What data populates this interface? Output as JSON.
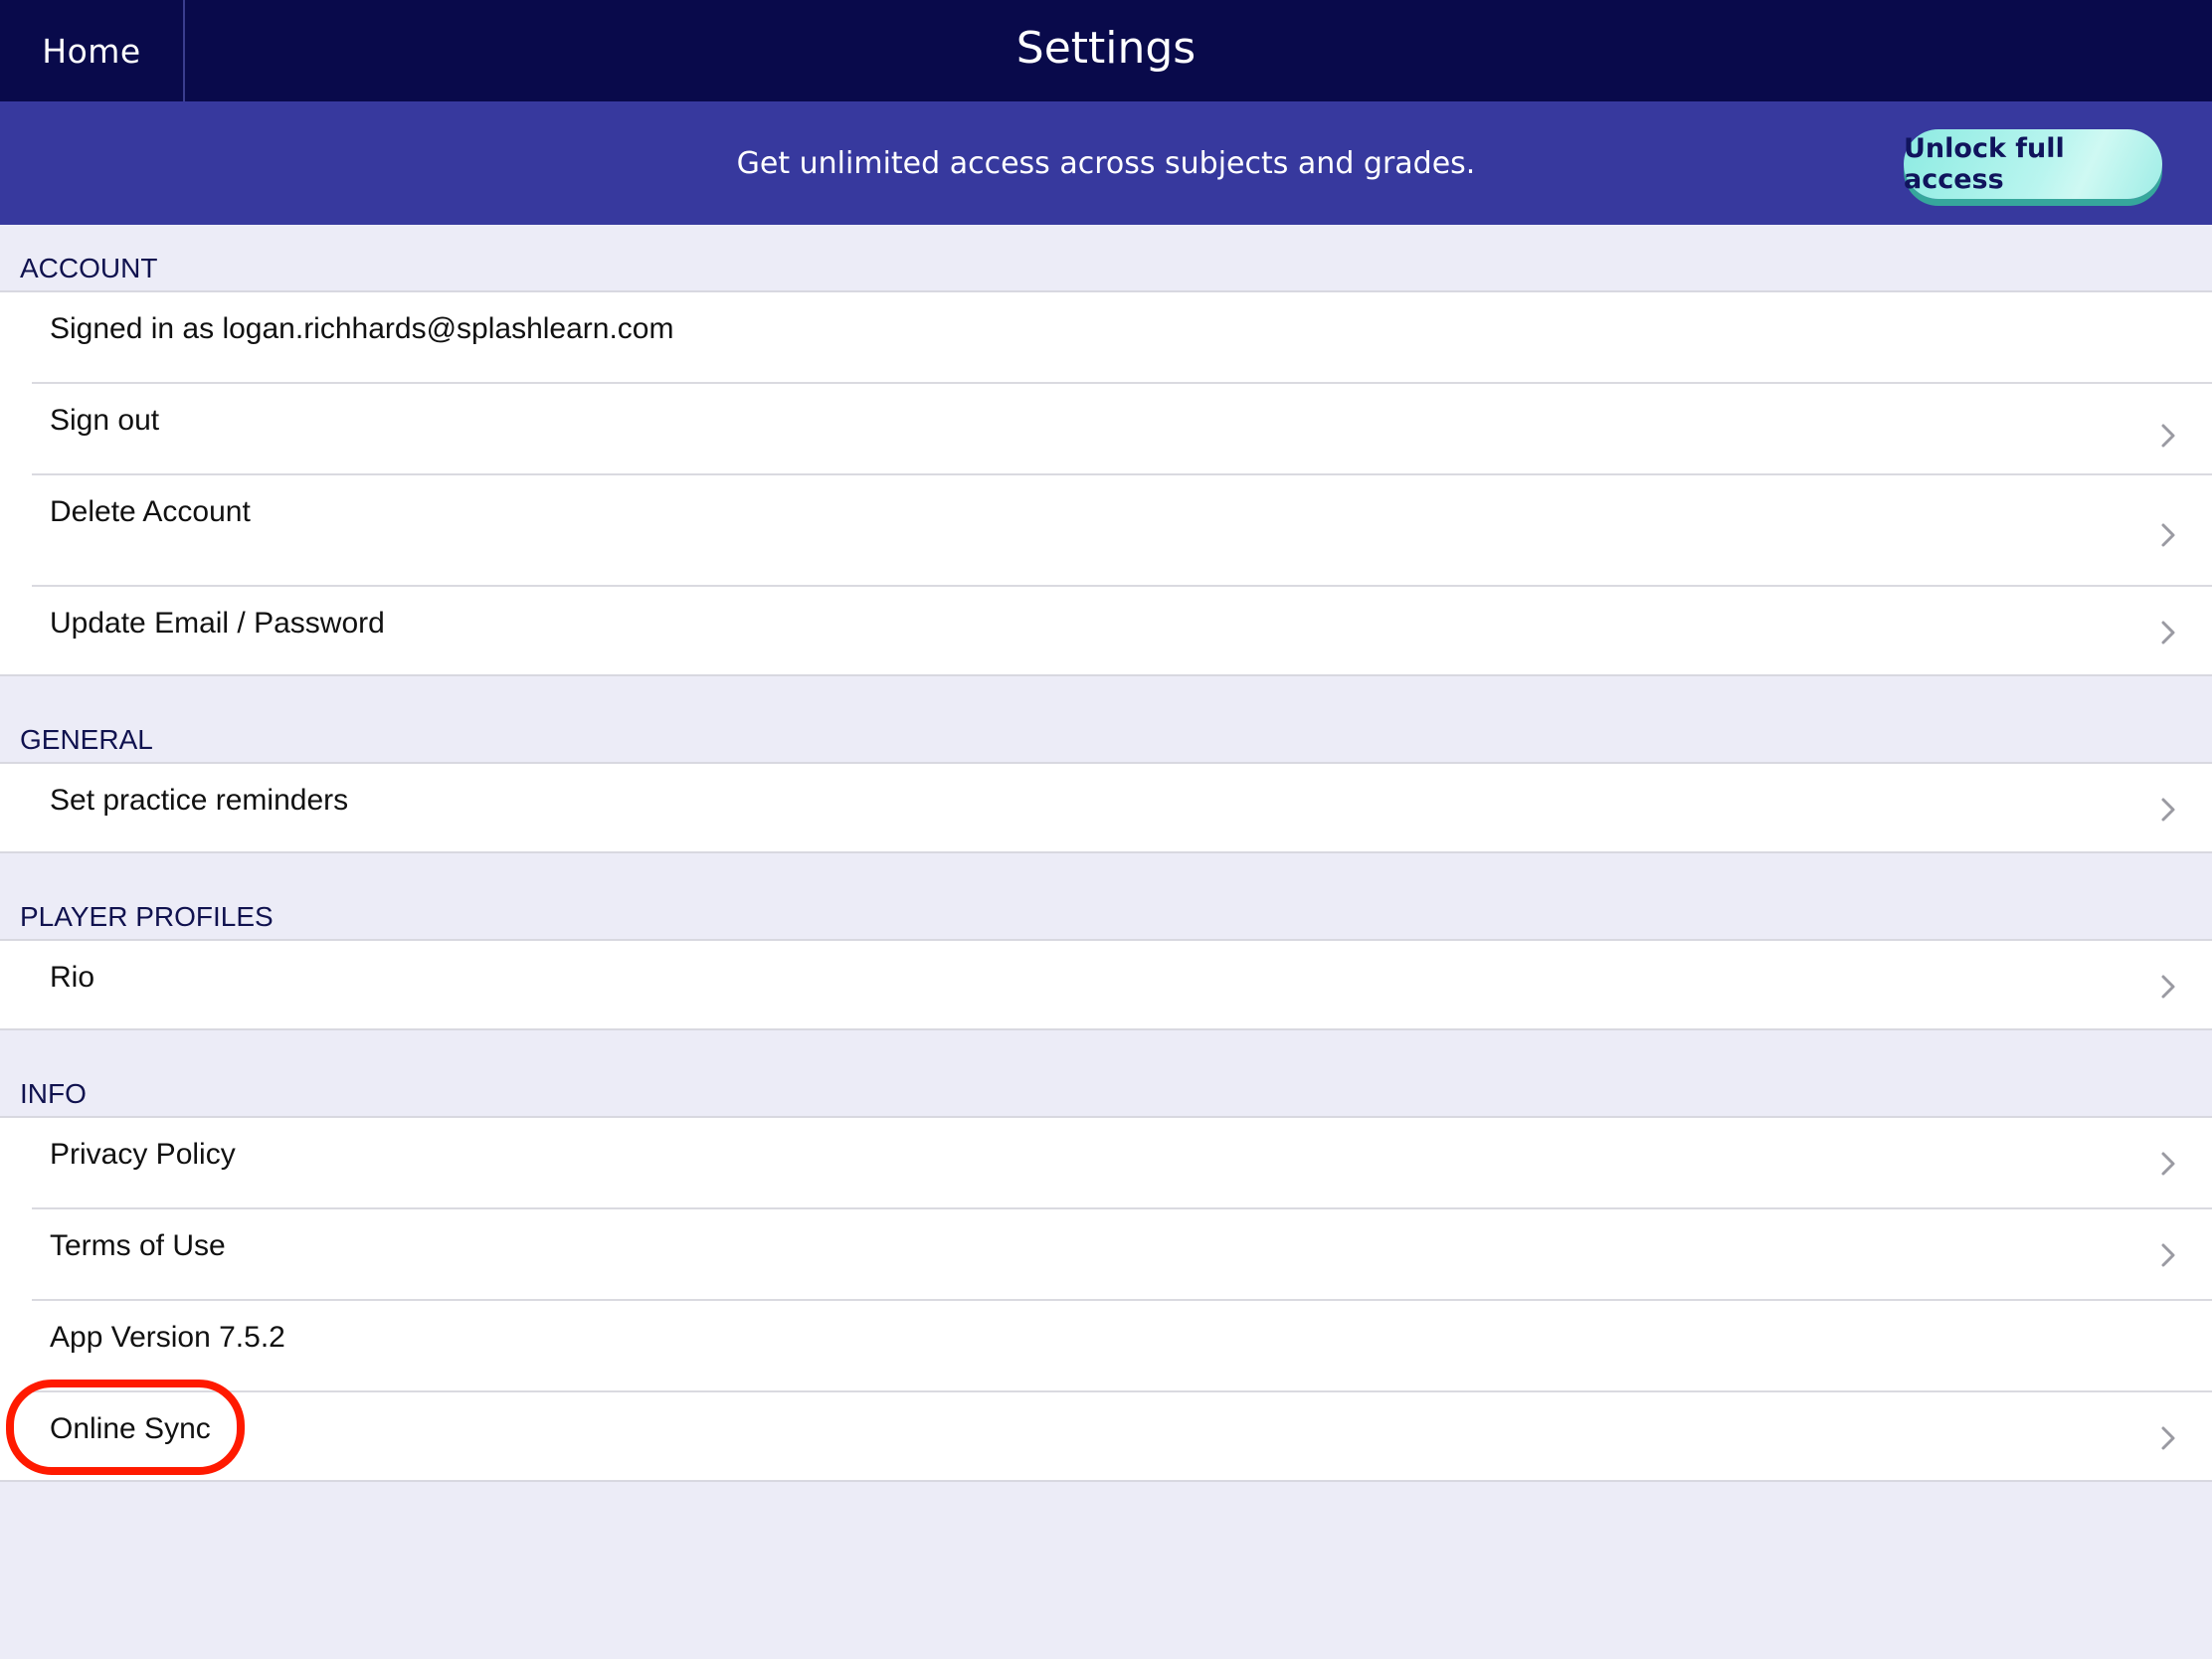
{
  "nav": {
    "home_label": "Home",
    "title": "Settings"
  },
  "banner": {
    "text": "Get unlimited access across subjects and grades.",
    "button_label": "Unlock full access"
  },
  "sections": {
    "account": {
      "header": "ACCOUNT",
      "items": [
        {
          "label": "Signed in as logan.richhards@splashlearn.com"
        },
        {
          "label": "Sign out"
        },
        {
          "label": "Delete Account"
        },
        {
          "label": "Update Email / Password"
        }
      ]
    },
    "general": {
      "header": "GENERAL",
      "items": [
        {
          "label": "Set practice reminders"
        }
      ]
    },
    "player_profiles": {
      "header": "PLAYER PROFILES",
      "items": [
        {
          "label": "Rio"
        }
      ]
    },
    "info": {
      "header": "INFO",
      "items": [
        {
          "label": "Privacy Policy"
        },
        {
          "label": "Terms of Use"
        },
        {
          "label": "App Version 7.5.2"
        },
        {
          "label": "Online Sync"
        }
      ]
    }
  },
  "colors": {
    "navbar": "#090A4B",
    "banner": "#37399E",
    "background": "#ECECF7",
    "button": "#9EEDE6",
    "highlight": "#FF1A00"
  },
  "icons": {
    "row_disclosure": "chevron-right-icon"
  }
}
